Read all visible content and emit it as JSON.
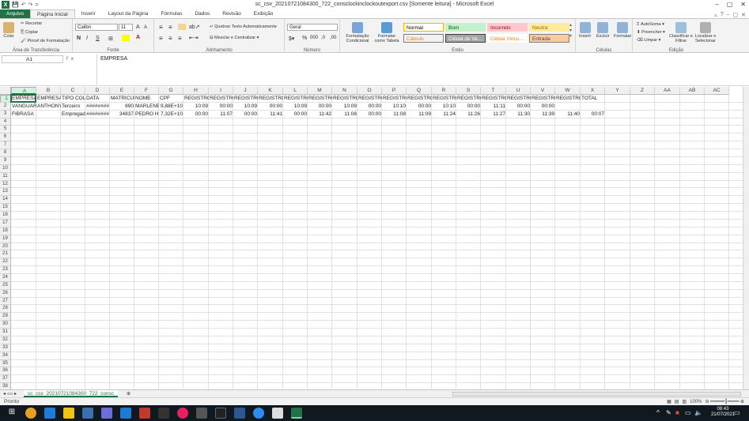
{
  "window": {
    "title": "sc_csv_20210721084300_722_consclockinclockoutexport.csv  [Somente leitura]  -  Microsoft Excel",
    "min": "–",
    "max": "▢",
    "close": "✕"
  },
  "qat": {
    "logo": "X",
    "save": "💾",
    "undo": "↶",
    "redo": "↷",
    "more": "="
  },
  "tabs": {
    "file": "Arquivo",
    "items": [
      "Página Inicial",
      "Inserir",
      "Layout da Página",
      "Fórmulas",
      "Dados",
      "Revisão",
      "Exibição"
    ]
  },
  "ribbon": {
    "clipboard": {
      "paste": "Colar",
      "cut": "Recortar",
      "copy": "Copiar",
      "painter": "Pincel de Formatação",
      "label": "Área de Transferência"
    },
    "font": {
      "name": "Calibri",
      "size": "11",
      "bold": "N",
      "italic": "I",
      "underline": "S",
      "grow": "A",
      "shrink": "A",
      "label": "Fonte"
    },
    "alignment": {
      "wrap": "Quebrar Texto Automaticamente",
      "merge": "Mesclar e Centralizar",
      "label": "Alinhamento"
    },
    "number": {
      "format": "Geral",
      "pct": "%",
      "thousands": "000",
      "dec_up": ",0",
      "dec_down": ",00",
      "label": "Número"
    },
    "styles": {
      "cond": "Formatação Condicional",
      "table": "Formatar como Tabela",
      "cells": [
        {
          "name": "Normal",
          "bg": "#ffffff",
          "fg": "#000000",
          "border": "#ffb000"
        },
        {
          "name": "Bom",
          "bg": "#c6efce",
          "fg": "#006100",
          "border": "#c6efce"
        },
        {
          "name": "Incorreto",
          "bg": "#ffc7ce",
          "fg": "#9c0006",
          "border": "#ffc7ce"
        },
        {
          "name": "Neutra",
          "bg": "#ffeb9c",
          "fg": "#9c6500",
          "border": "#ffeb9c"
        },
        {
          "name": "Cálculo",
          "bg": "#f2f2f2",
          "fg": "#fa7d00",
          "border": "#7f7f7f"
        },
        {
          "name": "Célula de Ve...",
          "bg": "#a5a5a5",
          "fg": "#ffffff",
          "border": "#3f3f3f"
        },
        {
          "name": "Célula Vincu...",
          "bg": "#ffffff",
          "fg": "#fa7d00",
          "border": "#ffffff"
        },
        {
          "name": "Entrada",
          "bg": "#ffcc99",
          "fg": "#3f3f76",
          "border": "#7f7f7f"
        }
      ],
      "label": "Estilo"
    },
    "cells_group": {
      "insert": "Inserir",
      "delete": "Excluir",
      "format": "Formatar",
      "label": "Células"
    },
    "editing": {
      "autosum": "AutoSoma",
      "fill": "Preencher",
      "clear": "Limpar",
      "sort": "Classificar e Filtrar",
      "find": "Localizar e Selecionar",
      "label": "Edição"
    }
  },
  "formula_bar": {
    "name_box": "A1",
    "fx": "fx",
    "content": "EMPRESA"
  },
  "grid": {
    "columns": [
      "A",
      "B",
      "C",
      "D",
      "E",
      "F",
      "G",
      "H",
      "I",
      "J",
      "K",
      "L",
      "M",
      "N",
      "O",
      "P",
      "Q",
      "R",
      "S",
      "T",
      "U",
      "V",
      "W",
      "X",
      "Y",
      "Z",
      "AA",
      "AB",
      "AC"
    ],
    "row_count": 38,
    "rows": [
      [
        "EMPRESA",
        "EMPRESA",
        "TIPO COL",
        "DATA",
        "MATRICUL",
        "NOME",
        "CPF",
        "REGISTRO",
        "REGISTRO",
        "REGISTRO",
        "REGISTRO",
        "REGISTRO",
        "REGISTRO",
        "REGISTRO",
        "REGISTRO",
        "REGISTRO",
        "REGISTRO",
        "REGISTRO",
        "REGISTRO",
        "REGISTRO",
        "REGISTRO",
        "REGISTRO",
        "REGISTRO",
        "TOTAL"
      ],
      [
        "VANGUAR",
        "ANTHONY",
        "Terceiro",
        "########",
        "890",
        "MARLENE",
        "9,88E+10",
        "10:09",
        "00:00",
        "10:09",
        "00:00",
        "10:09",
        "00:00",
        "10:09",
        "00:00",
        "10:10",
        "00:00",
        "10:10",
        "00:00",
        "11:11",
        "00:00",
        "00:00",
        "",
        ""
      ],
      [
        "FIBRASA",
        "",
        "Empregad",
        "########",
        "34837",
        "PEDRO HE",
        "7,32E+10",
        "00:00",
        "11:07",
        "00:00",
        "11:41",
        "00:00",
        "11:42",
        "11:08",
        "00:00",
        "11:08",
        "11:09",
        "11:24",
        "11:26",
        "11:27",
        "11:30",
        "11:39",
        "11:40",
        "00:07"
      ]
    ]
  },
  "sheet": {
    "tab": "sc_csv_20210721084300_722_consc"
  },
  "status": {
    "text": "Pronto",
    "zoom": "100%"
  },
  "taskbar": {
    "time": "08:43",
    "date": "21/07/2021"
  }
}
